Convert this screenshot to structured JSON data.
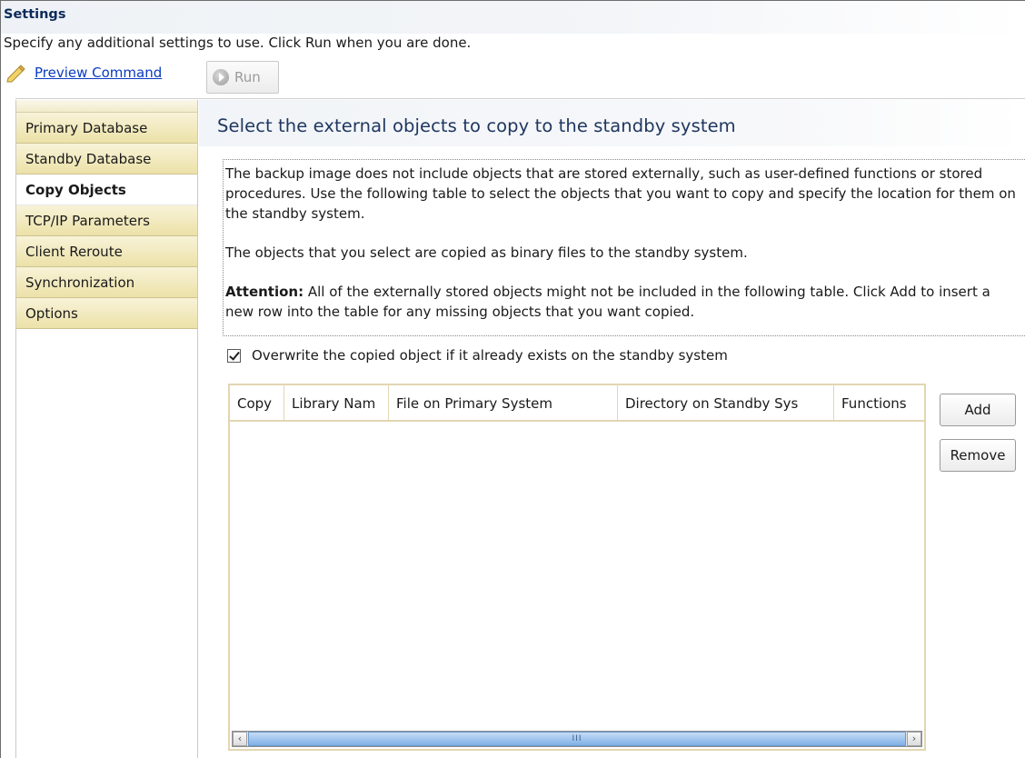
{
  "header": {
    "title": "Settings",
    "description": "Specify any additional settings to use. Click Run when you are done.",
    "preview_command": "Preview Command",
    "run_label": "Run"
  },
  "sidebar": {
    "items": [
      {
        "label": "Primary Database",
        "active": false
      },
      {
        "label": "Standby Database",
        "active": false
      },
      {
        "label": "Copy Objects",
        "active": true
      },
      {
        "label": "TCP/IP Parameters",
        "active": false
      },
      {
        "label": "Client Reroute",
        "active": false
      },
      {
        "label": "Synchronization",
        "active": false
      },
      {
        "label": "Options",
        "active": false
      }
    ]
  },
  "main": {
    "title": "Select the external objects to copy to the standby system",
    "paragraph1": "The backup image does not include objects that are stored externally, such as user-defined functions or stored procedures. Use the following table to select the objects that you want to copy and specify the location for them on the standby system.",
    "paragraph2": "The objects that you select are copied as binary files to the standby system.",
    "attention_label": "Attention:",
    "attention_text": " All of the externally stored objects might not be included in the following table. Click Add to insert a new row into the table for any missing objects that you want copied.",
    "overwrite_label": "Overwrite the copied object if it already exists on the standby system",
    "overwrite_checked": true,
    "table": {
      "columns": [
        "Copy",
        "Library Nam",
        "File on Primary System",
        "Directory on Standby Sys",
        "Functions"
      ],
      "rows": [],
      "scroll_thumb": "III"
    },
    "add_label": "Add",
    "remove_label": "Remove"
  },
  "colors": {
    "title": "#0d2a5a",
    "link": "#0b3cc1",
    "nav_tab": "#ece1a8",
    "table_border": "#e2d6b2",
    "scroll_thumb": "#7fb0e6"
  }
}
